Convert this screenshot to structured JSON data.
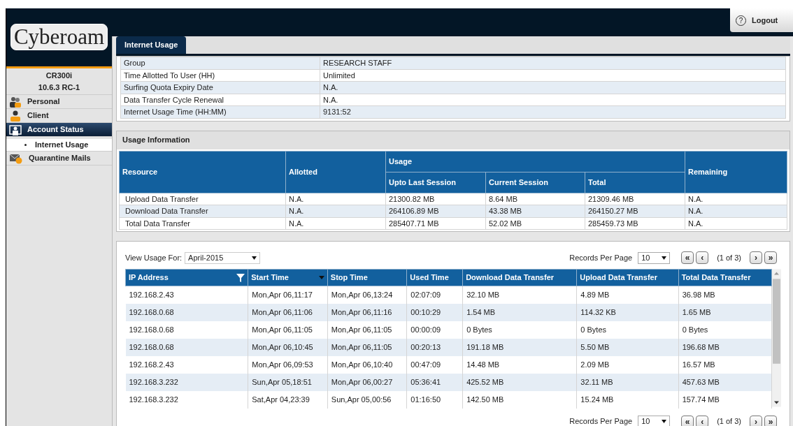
{
  "header": {
    "logo": "Cyberoam",
    "help": "?",
    "logout": "Logout"
  },
  "device": {
    "model": "CR300i",
    "version": "10.6.3 RC-1"
  },
  "sidebar": {
    "items": [
      {
        "label": "Personal",
        "kind": "people",
        "selected": false
      },
      {
        "label": "Client",
        "kind": "person",
        "selected": false
      },
      {
        "label": "Account Status",
        "kind": "status",
        "selected": true,
        "children": [
          {
            "label": "Internet Usage",
            "selected": true
          }
        ]
      },
      {
        "label": "Quarantine Mails",
        "kind": "mail",
        "selected": false
      }
    ]
  },
  "tabs": [
    {
      "label": "Internet Usage",
      "selected": true
    }
  ],
  "info": [
    {
      "label": "Group",
      "value": "RESEARCH STAFF"
    },
    {
      "label": "Time Allotted To User (HH)",
      "value": "Unlimited"
    },
    {
      "label": "Surfing Quota Expiry Date",
      "value": "N.A."
    },
    {
      "label": "Data Transfer Cycle Renewal",
      "value": "N.A."
    },
    {
      "label": "Internet Usage Time (HH:MM)",
      "value": "9131:52"
    }
  ],
  "usage_information": {
    "title": "Usage Information",
    "headers": {
      "resource": "Resource",
      "allotted": "Allotted",
      "usage": "Usage",
      "last": "Upto Last Session",
      "current": "Current Session",
      "total": "Total",
      "remaining": "Remaining"
    },
    "rows": [
      [
        "Upload Data Transfer",
        "N.A.",
        "21300.82 MB",
        "8.64 MB",
        "21309.46 MB",
        "N.A."
      ],
      [
        "Download Data Transfer",
        "N.A.",
        "264106.89 MB",
        "43.38 MB",
        "264150.27 MB",
        "N.A."
      ],
      [
        "Total Data Transfer",
        "N.A.",
        "285407.71 MB",
        "52.02 MB",
        "285459.73 MB",
        "N.A."
      ]
    ]
  },
  "sessions": {
    "view_label": "View Usage For:",
    "view_value": "April-2015",
    "top_pager": {
      "label": "Records Per Page",
      "per_page": "10",
      "first": "«",
      "prev": "‹",
      "status": "(1 of 3)",
      "next": "›",
      "last": "»"
    },
    "columns": [
      "IP Address",
      "Start Time",
      "Stop Time",
      "Used Time",
      "Download Data Transfer",
      "Upload Data Transfer",
      "Total Data Transfer"
    ],
    "rows": [
      [
        "192.168.2.43",
        "Mon,Apr 06,11:17",
        "Mon,Apr 06,13:24",
        "02:07:09",
        "32.10 MB",
        "4.89 MB",
        "36.98 MB"
      ],
      [
        "192.168.0.68",
        "Mon,Apr 06,11:06",
        "Mon,Apr 06,11:16",
        "00:10:29",
        "1.54 MB",
        "114.32 KB",
        "1.65 MB"
      ],
      [
        "192.168.0.68",
        "Mon,Apr 06,11:05",
        "Mon,Apr 06,11:05",
        "00:00:09",
        "0 Bytes",
        "0 Bytes",
        "0 Bytes"
      ],
      [
        "192.168.0.68",
        "Mon,Apr 06,10:45",
        "Mon,Apr 06,11:05",
        "00:20:13",
        "191.18 MB",
        "5.50 MB",
        "196.68 MB"
      ],
      [
        "192.168.2.43",
        "Mon,Apr 06,09:53",
        "Mon,Apr 06,10:40",
        "00:47:09",
        "14.48 MB",
        "2.09 MB",
        "16.57 MB"
      ],
      [
        "192.168.3.232",
        "Sun,Apr 05,18:51",
        "Mon,Apr 06,00:27",
        "05:36:41",
        "425.52 MB",
        "32.11 MB",
        "457.63 MB"
      ],
      [
        "192.168.3.232",
        "Sat,Apr 04,23:39",
        "Sun,Apr 05,00:56",
        "01:16:50",
        "142.50 MB",
        "15.24 MB",
        "157.74 MB"
      ]
    ],
    "bottom_pager": {
      "label": "Records Per Page",
      "per_page": "10",
      "first": "«",
      "prev": "‹",
      "status": "(1 of 3)",
      "next": "›",
      "last": "»"
    }
  }
}
